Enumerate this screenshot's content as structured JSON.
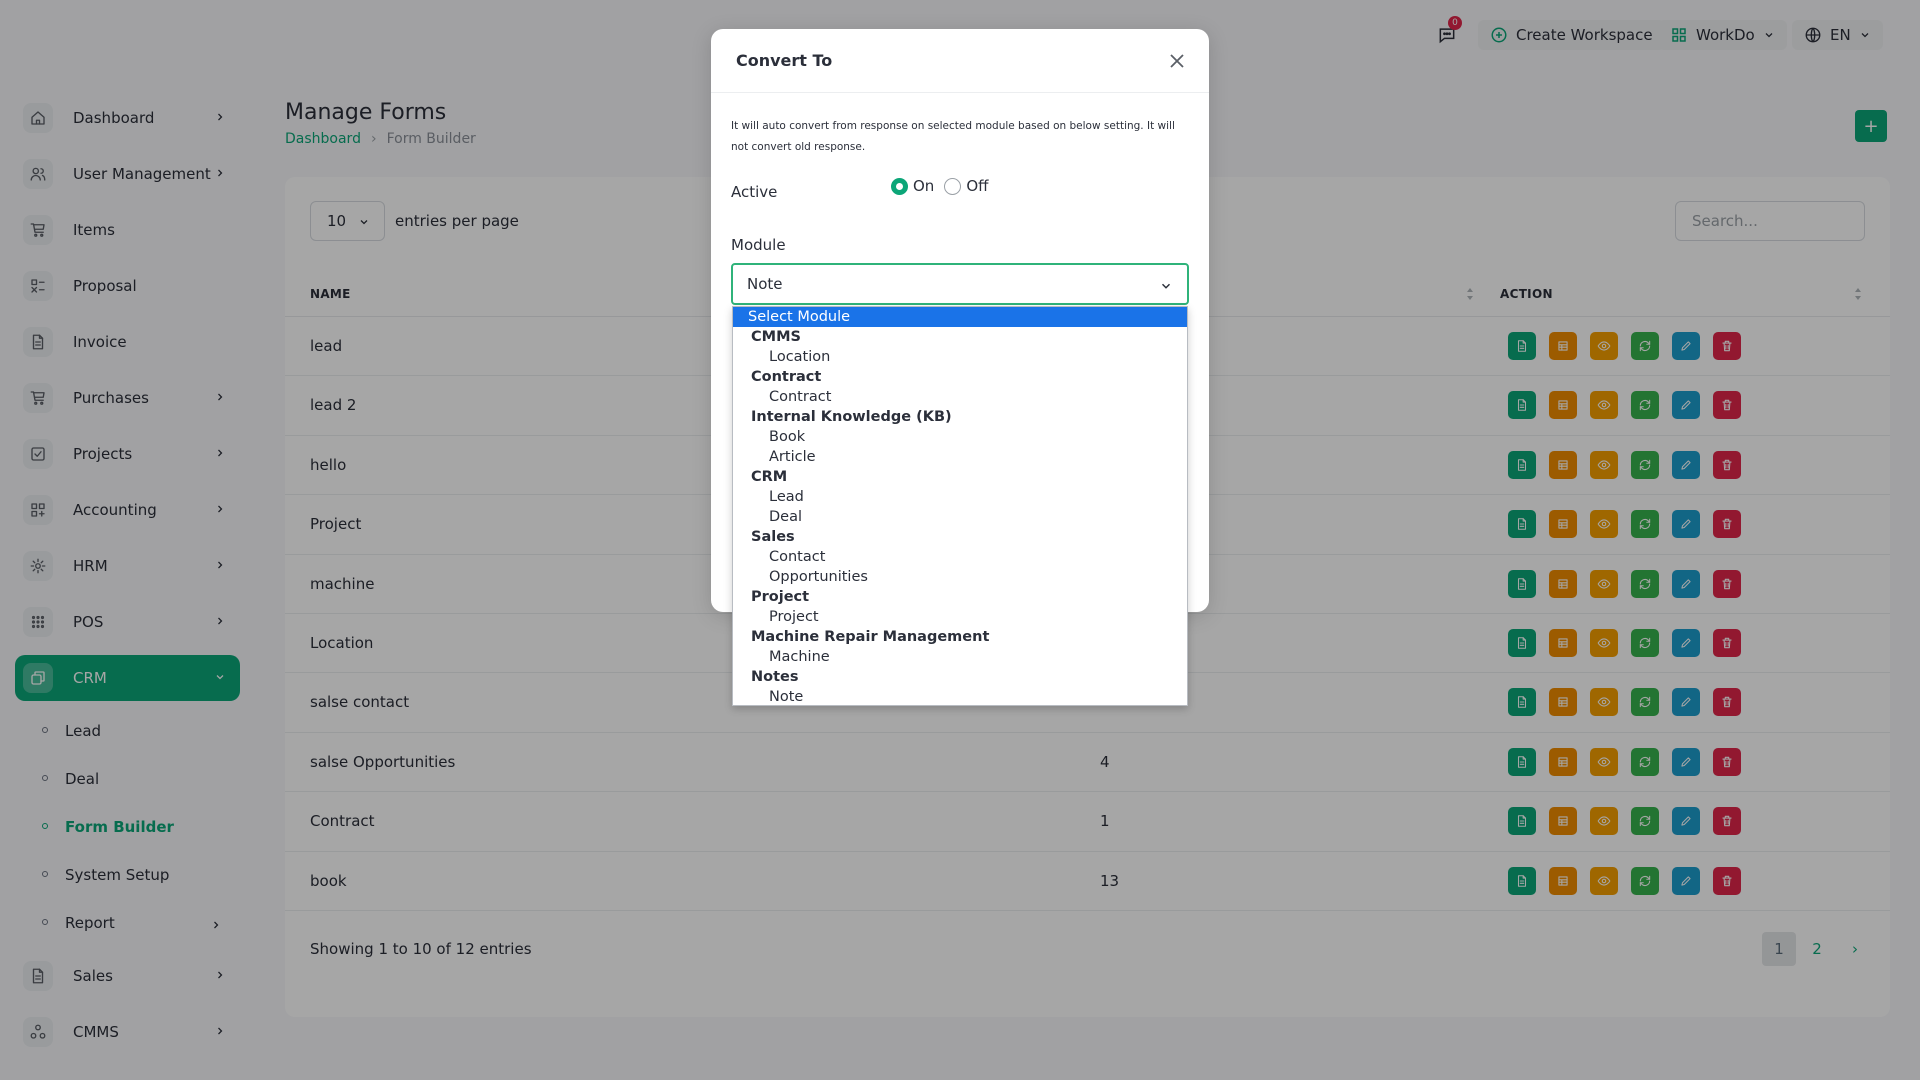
{
  "topbar": {
    "chat_badge": "0",
    "create_workspace": "Create Workspace",
    "workspace_name": "WorkDo",
    "language": "EN"
  },
  "sidebar": {
    "items": [
      {
        "label": "Dashboard",
        "icon": "home-icon",
        "has_chevron": true
      },
      {
        "label": "User Management",
        "icon": "users-icon",
        "has_chevron": true
      },
      {
        "label": "Items",
        "icon": "cart-icon",
        "has_chevron": false
      },
      {
        "label": "Proposal",
        "icon": "proposal-icon",
        "has_chevron": false
      },
      {
        "label": "Invoice",
        "icon": "file-icon",
        "has_chevron": false
      },
      {
        "label": "Purchases",
        "icon": "cart-icon",
        "has_chevron": true
      },
      {
        "label": "Projects",
        "icon": "checkbox-icon",
        "has_chevron": true
      },
      {
        "label": "Accounting",
        "icon": "grid-icon",
        "has_chevron": true
      },
      {
        "label": "HRM",
        "icon": "cog-icon",
        "has_chevron": true
      },
      {
        "label": "POS",
        "icon": "dots-grid-icon",
        "has_chevron": true
      },
      {
        "label": "CRM",
        "icon": "layers-icon",
        "has_chevron": true,
        "active": true
      }
    ],
    "crm_sub": [
      {
        "label": "Lead"
      },
      {
        "label": "Deal"
      },
      {
        "label": "Form Builder",
        "current": true
      },
      {
        "label": "System Setup"
      },
      {
        "label": "Report",
        "has_chevron": true
      }
    ],
    "after_items": [
      {
        "label": "Sales",
        "icon": "file-icon",
        "has_chevron": true
      },
      {
        "label": "CMMS",
        "icon": "nodes-icon",
        "has_chevron": true
      }
    ]
  },
  "page": {
    "title": "Manage Forms",
    "breadcrumb": {
      "root": "Dashboard",
      "current": "Form Builder"
    },
    "add_button": "+"
  },
  "table": {
    "per_page": "10",
    "per_page_label": "entries per page",
    "search_placeholder": "Search...",
    "headers": {
      "name": "NAME",
      "action": "ACTION"
    },
    "rows": [
      {
        "name": "lead",
        "responses": ""
      },
      {
        "name": "lead 2",
        "responses": ""
      },
      {
        "name": "hello",
        "responses": ""
      },
      {
        "name": "Project",
        "responses": ""
      },
      {
        "name": "machine",
        "responses": ""
      },
      {
        "name": "Location",
        "responses": ""
      },
      {
        "name": "salse contact",
        "responses": ""
      },
      {
        "name": "salse Opportunities",
        "responses": "4"
      },
      {
        "name": "Contract",
        "responses": "1"
      },
      {
        "name": "book",
        "responses": "13"
      }
    ],
    "action_colors": [
      "#0ca678",
      "#f08c00",
      "#f59f00",
      "#37b24d",
      "#1c9dcc",
      "#e0264a"
    ],
    "action_icons": [
      "file-icon",
      "table-icon",
      "eye-icon",
      "convert-icon",
      "pencil-icon",
      "trash-icon"
    ],
    "showing": "Showing 1 to 10 of 12 entries",
    "pages": [
      "1",
      "2",
      "›"
    ]
  },
  "modal": {
    "title": "Convert To",
    "note": "It will auto convert from response on selected module based on below setting. It will not convert old response.",
    "active_label": "Active",
    "radio_on": "On",
    "radio_off": "Off",
    "module_label": "Module",
    "module_value": "Note"
  },
  "dropdown": {
    "placeholder": "Select Module",
    "groups": [
      {
        "label": "CMMS",
        "options": [
          "Location"
        ]
      },
      {
        "label": "Contract",
        "options": [
          "Contract"
        ]
      },
      {
        "label": "Internal Knowledge (KB)",
        "options": [
          "Book",
          "Article"
        ]
      },
      {
        "label": "CRM",
        "options": [
          "Lead",
          "Deal"
        ]
      },
      {
        "label": "Sales",
        "options": [
          "Contact",
          "Opportunities"
        ]
      },
      {
        "label": "Project",
        "options": [
          "Project"
        ]
      },
      {
        "label": "Machine Repair Management",
        "options": [
          "Machine"
        ]
      },
      {
        "label": "Notes",
        "options": [
          "Note"
        ]
      }
    ]
  },
  "colors": {
    "accent": "#0ca678",
    "highlight": "#1a73e8",
    "danger": "#e0264a"
  }
}
